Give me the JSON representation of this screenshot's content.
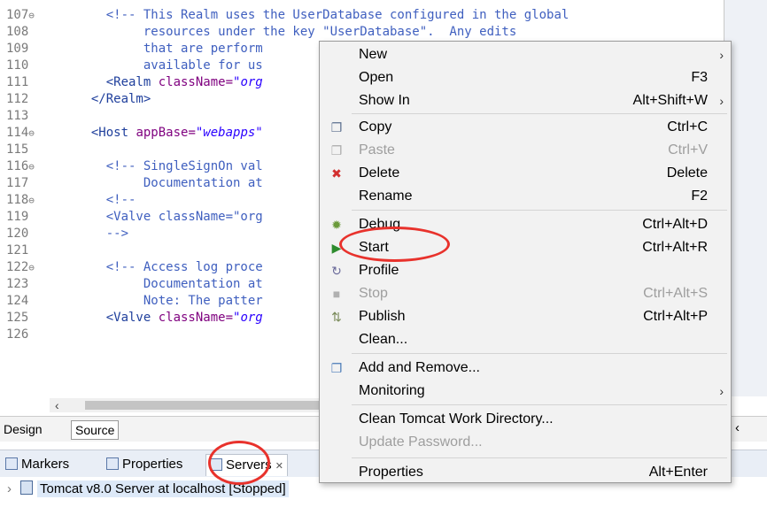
{
  "editor": {
    "lines": [
      {
        "n": "107",
        "fold": true,
        "segments": [
          [
            "cmt",
            "    <!-- This Realm uses the UserDatabase configured in the global"
          ]
        ]
      },
      {
        "n": "108",
        "fold": false,
        "segments": [
          [
            "cmt",
            "         resources under the key \"UserDatabase\".  Any edits"
          ]
        ]
      },
      {
        "n": "109",
        "fold": false,
        "segments": [
          [
            "cmt",
            "         that are perform"
          ]
        ]
      },
      {
        "n": "110",
        "fold": false,
        "segments": [
          [
            "cmt",
            "         available for us"
          ]
        ]
      },
      {
        "n": "111",
        "fold": false,
        "segments": [
          [
            "tag",
            "    <Realm "
          ],
          [
            "attr",
            "className="
          ],
          [
            "val",
            "\"org"
          ]
        ]
      },
      {
        "n": "112",
        "fold": false,
        "segments": [
          [
            "tag",
            "  </Realm>"
          ]
        ]
      },
      {
        "n": "113",
        "fold": false,
        "segments": []
      },
      {
        "n": "114",
        "fold": true,
        "segments": [
          [
            "tag",
            "  <Host "
          ],
          [
            "attr",
            "appBase="
          ],
          [
            "val",
            "\"webapps\""
          ]
        ]
      },
      {
        "n": "115",
        "fold": false,
        "segments": []
      },
      {
        "n": "116",
        "fold": true,
        "segments": [
          [
            "cmt",
            "    <!-- SingleSignOn val"
          ]
        ]
      },
      {
        "n": "117",
        "fold": false,
        "segments": [
          [
            "cmt",
            "         Documentation at"
          ]
        ]
      },
      {
        "n": "118",
        "fold": true,
        "segments": [
          [
            "cmt",
            "    <!--"
          ]
        ]
      },
      {
        "n": "119",
        "fold": false,
        "segments": [
          [
            "cmt",
            "    <Valve className=\"org"
          ]
        ]
      },
      {
        "n": "120",
        "fold": false,
        "segments": [
          [
            "cmt",
            "    -->"
          ]
        ]
      },
      {
        "n": "121",
        "fold": false,
        "segments": []
      },
      {
        "n": "122",
        "fold": true,
        "segments": [
          [
            "cmt",
            "    <!-- Access log proce"
          ]
        ]
      },
      {
        "n": "123",
        "fold": false,
        "segments": [
          [
            "cmt",
            "         Documentation at"
          ]
        ]
      },
      {
        "n": "124",
        "fold": false,
        "segments": [
          [
            "cmt",
            "         Note: The patter"
          ]
        ]
      },
      {
        "n": "125",
        "fold": false,
        "segments": [
          [
            "tag",
            "    <Valve "
          ],
          [
            "attr",
            "className="
          ],
          [
            "val",
            "\"org"
          ]
        ]
      },
      {
        "n": "126",
        "fold": false,
        "segments": []
      }
    ]
  },
  "editor_tabs": {
    "design": "Design",
    "source": "Source"
  },
  "views": {
    "markers": "Markers",
    "properties": "Properties",
    "servers": "Servers"
  },
  "servers_tree": {
    "item": "Tomcat v8.0 Server at localhost  [Stopped]"
  },
  "context_menu": {
    "items": [
      {
        "label": "New",
        "accel": "",
        "submenu": true,
        "disabled": false,
        "icon": ""
      },
      {
        "label": "Open",
        "accel": "F3",
        "submenu": false,
        "disabled": false,
        "icon": ""
      },
      {
        "label": "Show In",
        "accel": "Alt+Shift+W",
        "submenu": true,
        "disabled": false,
        "icon": ""
      },
      {
        "label": "Copy",
        "accel": "Ctrl+C",
        "submenu": false,
        "disabled": false,
        "icon": "copy-icon"
      },
      {
        "label": "Paste",
        "accel": "Ctrl+V",
        "submenu": false,
        "disabled": true,
        "icon": "paste-icon"
      },
      {
        "label": "Delete",
        "accel": "Delete",
        "submenu": false,
        "disabled": false,
        "icon": "delete-icon"
      },
      {
        "label": "Rename",
        "accel": "F2",
        "submenu": false,
        "disabled": false,
        "icon": ""
      },
      {
        "label": "Debug",
        "accel": "Ctrl+Alt+D",
        "submenu": false,
        "disabled": false,
        "icon": "debug-icon"
      },
      {
        "label": "Start",
        "accel": "Ctrl+Alt+R",
        "submenu": false,
        "disabled": false,
        "icon": "start-icon"
      },
      {
        "label": "Profile",
        "accel": "",
        "submenu": false,
        "disabled": false,
        "icon": "profile-icon"
      },
      {
        "label": "Stop",
        "accel": "Ctrl+Alt+S",
        "submenu": false,
        "disabled": true,
        "icon": "stop-icon"
      },
      {
        "label": "Publish",
        "accel": "Ctrl+Alt+P",
        "submenu": false,
        "disabled": false,
        "icon": "publish-icon"
      },
      {
        "label": "Clean...",
        "accel": "",
        "submenu": false,
        "disabled": false,
        "icon": ""
      },
      {
        "label": "Add and Remove...",
        "accel": "",
        "submenu": false,
        "disabled": false,
        "icon": "add-remove-icon"
      },
      {
        "label": "Monitoring",
        "accel": "",
        "submenu": true,
        "disabled": false,
        "icon": ""
      },
      {
        "label": "Clean Tomcat Work Directory...",
        "accel": "",
        "submenu": false,
        "disabled": false,
        "icon": ""
      },
      {
        "label": "Update Password...",
        "accel": "",
        "submenu": false,
        "disabled": true,
        "icon": ""
      },
      {
        "label": "Properties",
        "accel": "Alt+Enter",
        "submenu": false,
        "disabled": false,
        "icon": ""
      }
    ]
  },
  "colors": {
    "annotation": "#e8322c",
    "accent": "#3f5fbf"
  }
}
